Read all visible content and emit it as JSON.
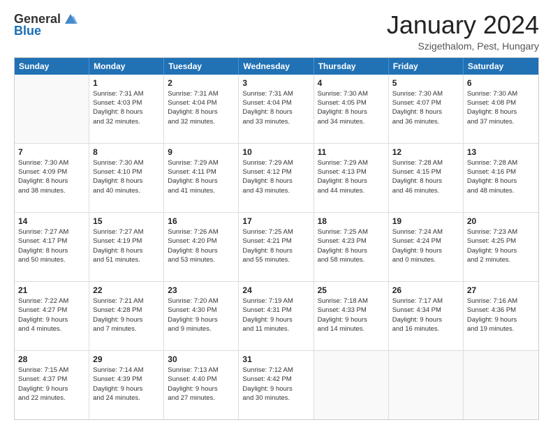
{
  "logo": {
    "general": "General",
    "blue": "Blue"
  },
  "header": {
    "month": "January 2024",
    "location": "Szigethalom, Pest, Hungary"
  },
  "days": [
    "Sunday",
    "Monday",
    "Tuesday",
    "Wednesday",
    "Thursday",
    "Friday",
    "Saturday"
  ],
  "weeks": [
    [
      {
        "day": "",
        "lines": []
      },
      {
        "day": "1",
        "lines": [
          "Sunrise: 7:31 AM",
          "Sunset: 4:03 PM",
          "Daylight: 8 hours",
          "and 32 minutes."
        ]
      },
      {
        "day": "2",
        "lines": [
          "Sunrise: 7:31 AM",
          "Sunset: 4:04 PM",
          "Daylight: 8 hours",
          "and 32 minutes."
        ]
      },
      {
        "day": "3",
        "lines": [
          "Sunrise: 7:31 AM",
          "Sunset: 4:04 PM",
          "Daylight: 8 hours",
          "and 33 minutes."
        ]
      },
      {
        "day": "4",
        "lines": [
          "Sunrise: 7:30 AM",
          "Sunset: 4:05 PM",
          "Daylight: 8 hours",
          "and 34 minutes."
        ]
      },
      {
        "day": "5",
        "lines": [
          "Sunrise: 7:30 AM",
          "Sunset: 4:07 PM",
          "Daylight: 8 hours",
          "and 36 minutes."
        ]
      },
      {
        "day": "6",
        "lines": [
          "Sunrise: 7:30 AM",
          "Sunset: 4:08 PM",
          "Daylight: 8 hours",
          "and 37 minutes."
        ]
      }
    ],
    [
      {
        "day": "7",
        "lines": [
          "Sunrise: 7:30 AM",
          "Sunset: 4:09 PM",
          "Daylight: 8 hours",
          "and 38 minutes."
        ]
      },
      {
        "day": "8",
        "lines": [
          "Sunrise: 7:30 AM",
          "Sunset: 4:10 PM",
          "Daylight: 8 hours",
          "and 40 minutes."
        ]
      },
      {
        "day": "9",
        "lines": [
          "Sunrise: 7:29 AM",
          "Sunset: 4:11 PM",
          "Daylight: 8 hours",
          "and 41 minutes."
        ]
      },
      {
        "day": "10",
        "lines": [
          "Sunrise: 7:29 AM",
          "Sunset: 4:12 PM",
          "Daylight: 8 hours",
          "and 43 minutes."
        ]
      },
      {
        "day": "11",
        "lines": [
          "Sunrise: 7:29 AM",
          "Sunset: 4:13 PM",
          "Daylight: 8 hours",
          "and 44 minutes."
        ]
      },
      {
        "day": "12",
        "lines": [
          "Sunrise: 7:28 AM",
          "Sunset: 4:15 PM",
          "Daylight: 8 hours",
          "and 46 minutes."
        ]
      },
      {
        "day": "13",
        "lines": [
          "Sunrise: 7:28 AM",
          "Sunset: 4:16 PM",
          "Daylight: 8 hours",
          "and 48 minutes."
        ]
      }
    ],
    [
      {
        "day": "14",
        "lines": [
          "Sunrise: 7:27 AM",
          "Sunset: 4:17 PM",
          "Daylight: 8 hours",
          "and 50 minutes."
        ]
      },
      {
        "day": "15",
        "lines": [
          "Sunrise: 7:27 AM",
          "Sunset: 4:19 PM",
          "Daylight: 8 hours",
          "and 51 minutes."
        ]
      },
      {
        "day": "16",
        "lines": [
          "Sunrise: 7:26 AM",
          "Sunset: 4:20 PM",
          "Daylight: 8 hours",
          "and 53 minutes."
        ]
      },
      {
        "day": "17",
        "lines": [
          "Sunrise: 7:25 AM",
          "Sunset: 4:21 PM",
          "Daylight: 8 hours",
          "and 55 minutes."
        ]
      },
      {
        "day": "18",
        "lines": [
          "Sunrise: 7:25 AM",
          "Sunset: 4:23 PM",
          "Daylight: 8 hours",
          "and 58 minutes."
        ]
      },
      {
        "day": "19",
        "lines": [
          "Sunrise: 7:24 AM",
          "Sunset: 4:24 PM",
          "Daylight: 9 hours",
          "and 0 minutes."
        ]
      },
      {
        "day": "20",
        "lines": [
          "Sunrise: 7:23 AM",
          "Sunset: 4:25 PM",
          "Daylight: 9 hours",
          "and 2 minutes."
        ]
      }
    ],
    [
      {
        "day": "21",
        "lines": [
          "Sunrise: 7:22 AM",
          "Sunset: 4:27 PM",
          "Daylight: 9 hours",
          "and 4 minutes."
        ]
      },
      {
        "day": "22",
        "lines": [
          "Sunrise: 7:21 AM",
          "Sunset: 4:28 PM",
          "Daylight: 9 hours",
          "and 7 minutes."
        ]
      },
      {
        "day": "23",
        "lines": [
          "Sunrise: 7:20 AM",
          "Sunset: 4:30 PM",
          "Daylight: 9 hours",
          "and 9 minutes."
        ]
      },
      {
        "day": "24",
        "lines": [
          "Sunrise: 7:19 AM",
          "Sunset: 4:31 PM",
          "Daylight: 9 hours",
          "and 11 minutes."
        ]
      },
      {
        "day": "25",
        "lines": [
          "Sunrise: 7:18 AM",
          "Sunset: 4:33 PM",
          "Daylight: 9 hours",
          "and 14 minutes."
        ]
      },
      {
        "day": "26",
        "lines": [
          "Sunrise: 7:17 AM",
          "Sunset: 4:34 PM",
          "Daylight: 9 hours",
          "and 16 minutes."
        ]
      },
      {
        "day": "27",
        "lines": [
          "Sunrise: 7:16 AM",
          "Sunset: 4:36 PM",
          "Daylight: 9 hours",
          "and 19 minutes."
        ]
      }
    ],
    [
      {
        "day": "28",
        "lines": [
          "Sunrise: 7:15 AM",
          "Sunset: 4:37 PM",
          "Daylight: 9 hours",
          "and 22 minutes."
        ]
      },
      {
        "day": "29",
        "lines": [
          "Sunrise: 7:14 AM",
          "Sunset: 4:39 PM",
          "Daylight: 9 hours",
          "and 24 minutes."
        ]
      },
      {
        "day": "30",
        "lines": [
          "Sunrise: 7:13 AM",
          "Sunset: 4:40 PM",
          "Daylight: 9 hours",
          "and 27 minutes."
        ]
      },
      {
        "day": "31",
        "lines": [
          "Sunrise: 7:12 AM",
          "Sunset: 4:42 PM",
          "Daylight: 9 hours",
          "and 30 minutes."
        ]
      },
      {
        "day": "",
        "lines": []
      },
      {
        "day": "",
        "lines": []
      },
      {
        "day": "",
        "lines": []
      }
    ]
  ]
}
